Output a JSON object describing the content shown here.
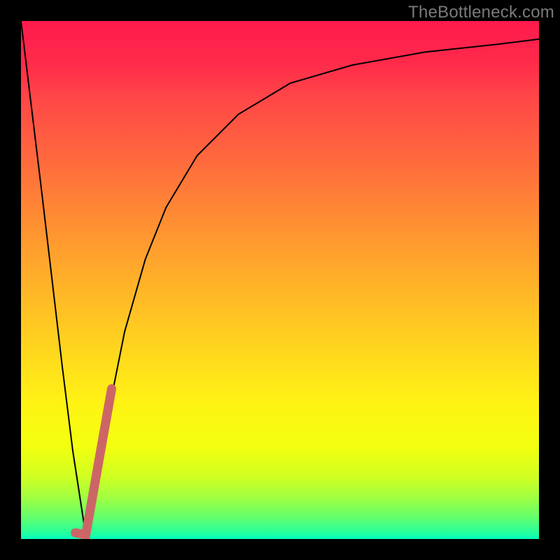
{
  "watermark": {
    "text": "TheBottleneck.com"
  },
  "gradient": {
    "top": "#ff1a4d",
    "mid_high": "#ff8c33",
    "mid": "#ffd21f",
    "mid_low": "#d0ff22",
    "bottom": "#00ffc0"
  },
  "chart_data": {
    "type": "line",
    "title": "",
    "xlabel": "",
    "ylabel": "",
    "xlim": [
      0,
      100
    ],
    "ylim": [
      0,
      100
    ],
    "grid": false,
    "series": [
      {
        "name": "bottleneck-curve",
        "x": [
          0,
          4,
          8,
          10,
          12,
          12.5,
          13,
          14,
          16,
          20,
          24,
          28,
          34,
          42,
          52,
          64,
          78,
          92,
          100
        ],
        "y": [
          100,
          67,
          33,
          17,
          4,
          0.5,
          1,
          7,
          20,
          40,
          54,
          64,
          74,
          82,
          88,
          91.5,
          94,
          95.5,
          96.5
        ],
        "stroke": "#000000",
        "width": 2
      },
      {
        "name": "highlight-segment",
        "x": [
          10.5,
          12.5,
          17.5
        ],
        "y": [
          1.2,
          0.8,
          29
        ],
        "stroke": "#cc6666",
        "width": 13,
        "linecap": "round"
      }
    ]
  }
}
